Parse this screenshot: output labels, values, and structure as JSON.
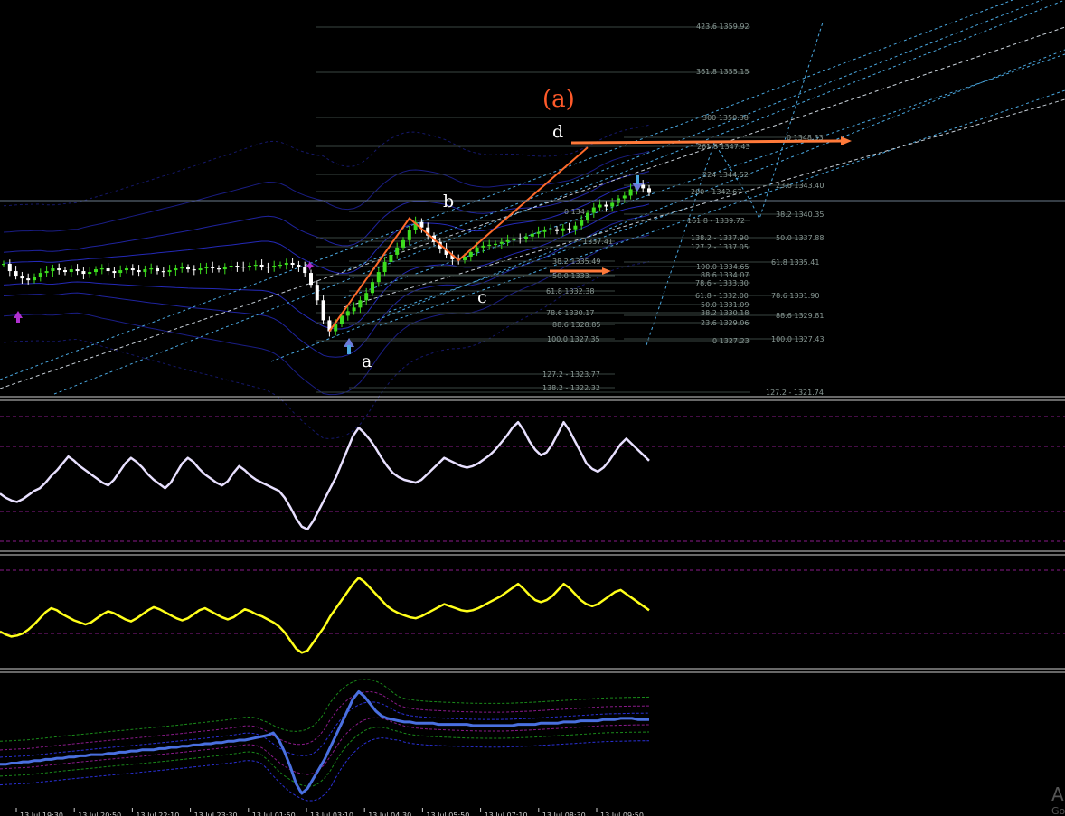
{
  "colors": {
    "background": "#000000",
    "bull_candle": "#3cdc1e",
    "bear_candle": "#ffffff",
    "wave_line": "#ff6a2a",
    "fib_line": "#3a4642",
    "fib_text": "#8a9a96",
    "channel": "#2a30d8",
    "channel_dotted": "#4aa8e0",
    "stoch1": "#e8e0ff",
    "stoch2": "#ffff1a",
    "osc3": "#4a70e0",
    "guide_magenta": "#8a1a8a"
  },
  "labels": {
    "wave_a": "a",
    "wave_b": "b",
    "wave_c": "c",
    "wave_d": "d",
    "wave_degree": "(a)",
    "corner_letter": "A",
    "corner_sub": "Go"
  },
  "fib_levels_mid": [
    "423.6 1359.92",
    "361.8 1355.15",
    "300 1350.38",
    "261.8 1347.43",
    "224 1344.52",
    "200 - 1342.67",
    "161.8 - 1339.72",
    "138.2 - 1337.90",
    "127.2 - 1337.05",
    "100.0 1334.65",
    "88.6 1334.07",
    "78.6 - 1333.30",
    "61.8 - 1332.00",
    "50.0 1331.09",
    "38.2 1330.18",
    "23.6 1329.06",
    "0 1327.23",
    "127.2 - 1321.74"
  ],
  "fib_levels_left": [
    "0 134",
    "1337.41",
    "38.2 1335.49",
    "50.0 1333.",
    "61.8 1332.38",
    "78.6 1330.17",
    "88.6 1328.85",
    "100.0 1327.35",
    "127.2 - 1323.77",
    "138.2 - 1322.32"
  ],
  "fib_levels_right": [
    "0 1348.33",
    "23.6 1343.40",
    "38.2 1340.35",
    "50.0 1337.88",
    "61.8 1335.41",
    "78.6 1331.90",
    "88.6 1329.81",
    "100.0 1327.43"
  ],
  "time_axis": [
    "13 Jul 19:30",
    "13 Jul 20:50",
    "13 Jul 22:10",
    "13 Jul 23:30",
    "13 Jul 01:50",
    "13 Jul 03:10",
    "13 Jul 04:30",
    "13 Jul 05:50",
    "13 Jul 07:10",
    "13 Jul 08:30",
    "13 Jul 09:50"
  ],
  "chart_data": [
    {
      "type": "line",
      "panel": "price",
      "description_series": "candlestick price with Elliott wave labels a-b-c-d and Fibonacci extension levels",
      "y_range": [
        1320.5,
        1363.0
      ],
      "close": [
        1334.8,
        1334.0,
        1333.5,
        1333.2,
        1333.0,
        1333.4,
        1333.8,
        1334.0,
        1334.3,
        1334.1,
        1333.9,
        1334.2,
        1334.0,
        1333.7,
        1333.9,
        1334.2,
        1334.3,
        1334.0,
        1333.8,
        1334.1,
        1334.3,
        1334.1,
        1333.9,
        1334.2,
        1334.3,
        1334.0,
        1333.9,
        1334.1,
        1334.3,
        1334.4,
        1334.2,
        1334.1,
        1334.3,
        1334.5,
        1334.3,
        1334.2,
        1334.4,
        1334.6,
        1334.5,
        1334.4,
        1334.6,
        1334.7,
        1334.5,
        1334.4,
        1334.6,
        1334.7,
        1334.9,
        1334.7,
        1334.5,
        1333.8,
        1332.5,
        1330.8,
        1328.6,
        1327.4,
        1328.2,
        1329.1,
        1329.6,
        1330.0,
        1330.8,
        1331.6,
        1332.8,
        1333.9,
        1335.0,
        1335.8,
        1336.6,
        1337.4,
        1338.5,
        1339.4,
        1338.8,
        1337.9,
        1337.2,
        1336.5,
        1335.8,
        1335.3,
        1335.2,
        1335.6,
        1336.1,
        1336.6,
        1336.8,
        1336.9,
        1337.0,
        1337.2,
        1337.4,
        1337.6,
        1337.5,
        1337.8,
        1338.1,
        1338.3,
        1338.5,
        1338.6,
        1338.4,
        1338.7,
        1338.6,
        1339.0,
        1339.6,
        1340.4,
        1341.0,
        1341.3,
        1341.1,
        1341.5,
        1342.0,
        1342.3,
        1343.0,
        1343.5,
        1343.1,
        1342.6
      ],
      "wave_points_x_index": [
        53,
        66,
        74,
        95
      ],
      "wave_points_y": [
        1327.4,
        1339.8,
        1335.2,
        1347.6
      ],
      "wave_labels": [
        "a",
        "b",
        "c",
        "d"
      ],
      "degree_label": "(a)"
    },
    {
      "type": "line",
      "panel": "oscillator-1",
      "series": [
        {
          "values": [
            38,
            35,
            33,
            32,
            34,
            37,
            40,
            42,
            46,
            51,
            55,
            60,
            65,
            62,
            58,
            55,
            52,
            49,
            46,
            44,
            48,
            54,
            60,
            64,
            61,
            57,
            52,
            48,
            45,
            42,
            46,
            53,
            60,
            64,
            61,
            56,
            52,
            49,
            46,
            44,
            47,
            53,
            58,
            55,
            51,
            48,
            46,
            44,
            42,
            40,
            35,
            28,
            20,
            14,
            12,
            18,
            26,
            34,
            42,
            50,
            60,
            70,
            80,
            86,
            82,
            77,
            71,
            64,
            58,
            53,
            50,
            48,
            47,
            46,
            48,
            52,
            56,
            60,
            64,
            62,
            60,
            58,
            57,
            58,
            60,
            63,
            66,
            70,
            75,
            80,
            86,
            90,
            84,
            76,
            70,
            66,
            68,
            74,
            82,
            90,
            84,
            76,
            68,
            60,
            56,
            54,
            57,
            62,
            68,
            74,
            78,
            74,
            70,
            66,
            62
          ]
        }
      ],
      "y_range": [
        0,
        100
      ]
    },
    {
      "type": "line",
      "panel": "oscillator-2",
      "series": [
        {
          "values": [
            35,
            32,
            30,
            31,
            33,
            37,
            42,
            48,
            54,
            58,
            56,
            52,
            49,
            46,
            44,
            42,
            44,
            48,
            52,
            55,
            53,
            50,
            47,
            45,
            48,
            52,
            56,
            59,
            57,
            54,
            51,
            48,
            46,
            48,
            52,
            56,
            58,
            55,
            52,
            49,
            47,
            49,
            53,
            57,
            55,
            52,
            50,
            47,
            44,
            40,
            34,
            26,
            18,
            14,
            16,
            24,
            32,
            40,
            50,
            58,
            66,
            74,
            82,
            88,
            84,
            78,
            72,
            66,
            60,
            56,
            53,
            51,
            49,
            48,
            50,
            53,
            56,
            59,
            62,
            60,
            58,
            56,
            55,
            56,
            58,
            61,
            64,
            67,
            70,
            74,
            78,
            82,
            77,
            71,
            66,
            64,
            66,
            70,
            76,
            82,
            78,
            72,
            66,
            62,
            60,
            62,
            66,
            70,
            74,
            76,
            72,
            68,
            64,
            60,
            56
          ]
        }
      ],
      "y_range": [
        0,
        100
      ]
    },
    {
      "type": "line",
      "panel": "oscillator-3",
      "series": [
        {
          "values": [
            30,
            30,
            31,
            31,
            32,
            32,
            33,
            33,
            34,
            34,
            35,
            35,
            36,
            36,
            37,
            37,
            38,
            38,
            38,
            39,
            39,
            40,
            40,
            41,
            41,
            42,
            42,
            42,
            43,
            43,
            44,
            44,
            45,
            45,
            46,
            46,
            47,
            47,
            48,
            48,
            49,
            49,
            50,
            50,
            51,
            52,
            53,
            54,
            56,
            50,
            40,
            28,
            14,
            6,
            10,
            18,
            26,
            34,
            44,
            54,
            64,
            74,
            84,
            90,
            86,
            80,
            74,
            70,
            68,
            67,
            66,
            65,
            65,
            64,
            64,
            64,
            64,
            63,
            63,
            63,
            63,
            63,
            63,
            62,
            62,
            62,
            62,
            62,
            62,
            62,
            62,
            63,
            63,
            63,
            63,
            64,
            64,
            64,
            64,
            65,
            65,
            65,
            66,
            66,
            66,
            66,
            67,
            67,
            67,
            68,
            68,
            68,
            67,
            67,
            67
          ]
        }
      ],
      "y_range": [
        0,
        100
      ]
    }
  ]
}
